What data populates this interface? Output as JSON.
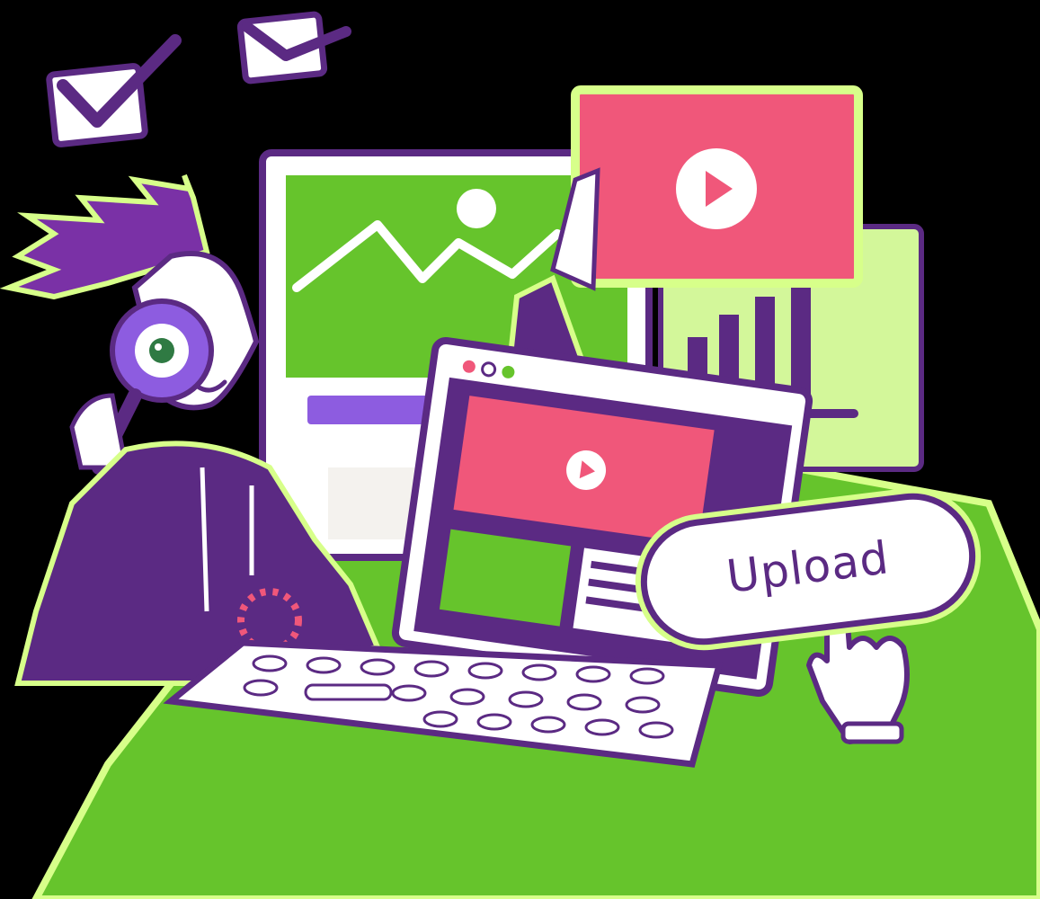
{
  "upload_button": {
    "label": "Upload"
  },
  "colors": {
    "background": "#000000",
    "desk_green": "#66c42c",
    "glow": "#d7ff8a",
    "purple": "#5b2a83",
    "violet": "#8d5ce0",
    "pink": "#f0577a",
    "white": "#ffffff",
    "light_green": "#d3f79a"
  },
  "icons": [
    "checkbox-check-icon",
    "play-icon",
    "image-icon",
    "bar-chart-icon",
    "magnifier-icon",
    "hand-cursor-icon"
  ]
}
